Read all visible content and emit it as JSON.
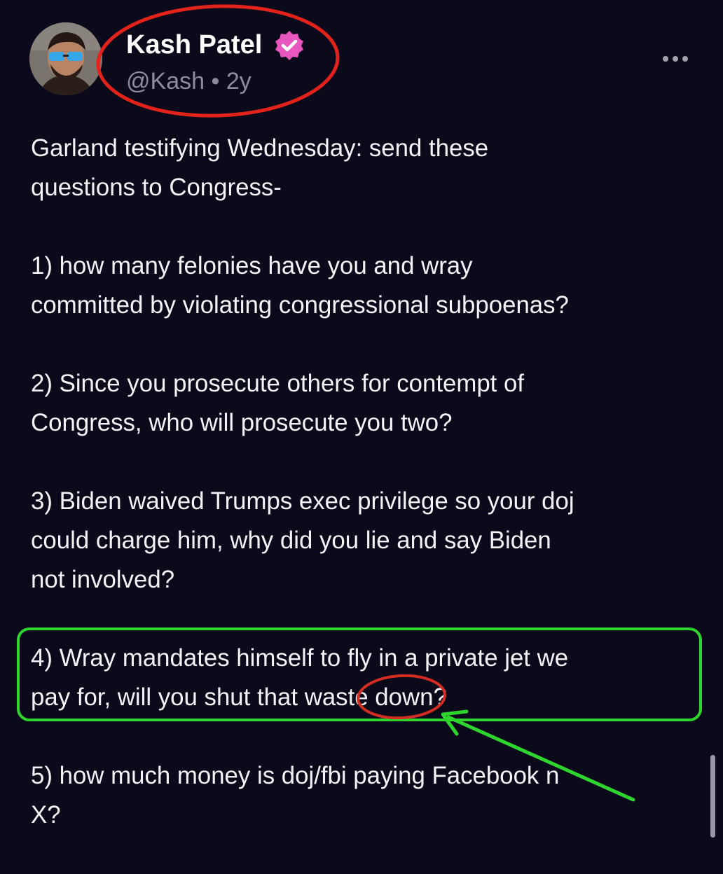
{
  "post": {
    "author": {
      "display_name": "Kash Patel",
      "handle": "@Kash",
      "separator": "•",
      "age": "2y",
      "verified": true,
      "verified_color": "#e857c0"
    },
    "menu_icon": "more-horizontal-icon",
    "lines": {
      "intro_1": "Garland testifying Wednesday: send these",
      "intro_2": "questions to Congress-",
      "q1_1": "1) how many felonies have you and wray",
      "q1_2": "committed by violating congressional subpoenas?",
      "q2_1": "2) Since you prosecute others for contempt of",
      "q2_2": "Congress, who will prosecute you two?",
      "q3_1": "3) Biden waived Trumps exec privilege so your doj",
      "q3_2": "could charge him, why did you lie and say Biden",
      "q3_3": "not involved?",
      "q4_1": "4) Wray mandates himself to fly in a private jet we",
      "q4_2": "pay for, will you shut that waste down?",
      "q5_1": "5) how much money is doj/fbi paying Facebook n",
      "q5_2": "X?"
    }
  },
  "annotations": {
    "name_circle_color": "#e3231b",
    "highlight_box_color": "#2fd52f",
    "word_circle_color": "#d32c22",
    "arrow_color": "#2fd52f"
  },
  "theme": {
    "background": "#0b0a1b",
    "text": "#f3f3f6",
    "muted": "#8e8c9a"
  }
}
